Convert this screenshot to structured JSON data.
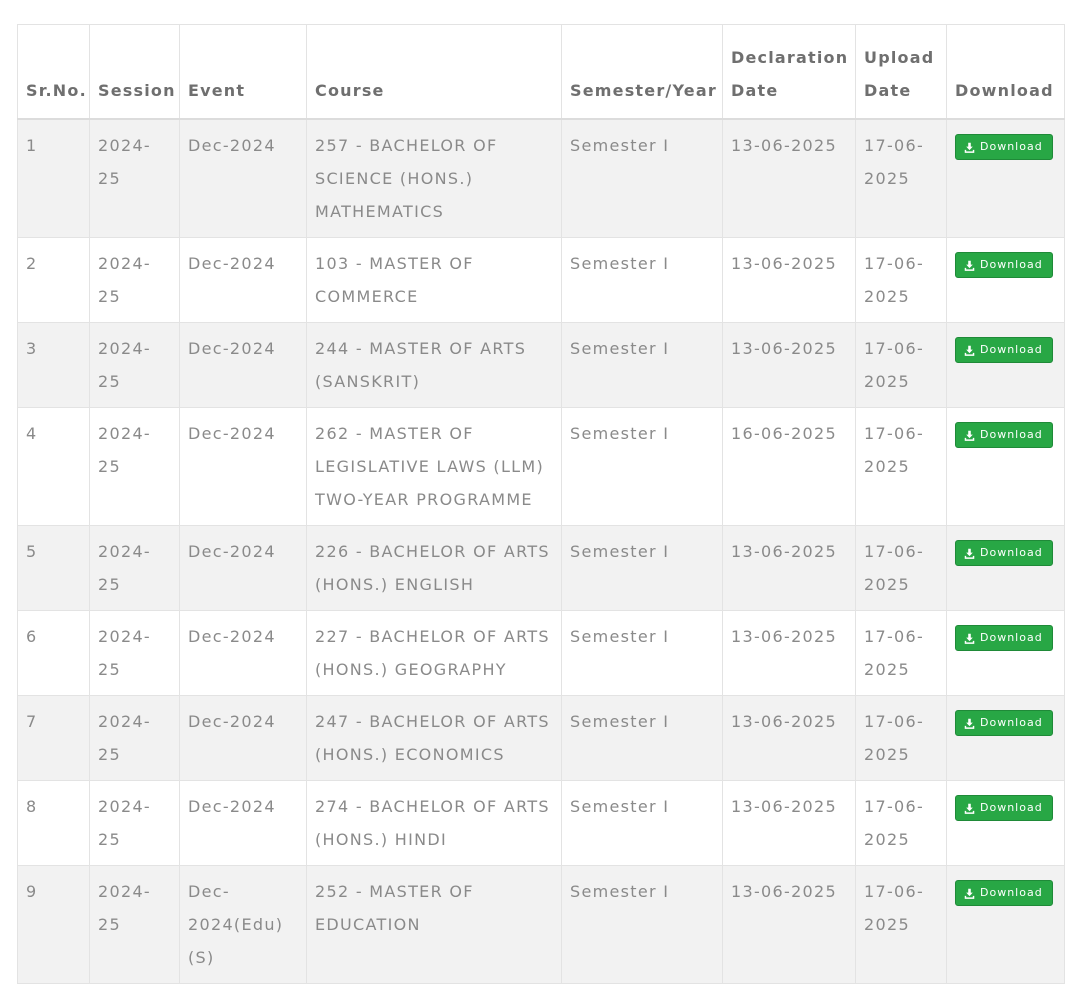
{
  "table": {
    "headers": {
      "sr": "Sr.No.",
      "session": "Session",
      "event": "Event",
      "course": "Course",
      "semester": "Semester/Year",
      "declaration": "Declaration Date",
      "upload": "Upload Date",
      "download": "Download"
    },
    "download_label": "Download",
    "rows": [
      {
        "sr": "1",
        "session": "2024-25",
        "event": "Dec-2024",
        "course": "257 - BACHELOR OF SCIENCE (HONS.) MATHEMATICS",
        "semester": "Semester I",
        "declaration": "13-06-2025",
        "upload": "17-06-2025"
      },
      {
        "sr": "2",
        "session": "2024-25",
        "event": "Dec-2024",
        "course": "103 - MASTER OF COMMERCE",
        "semester": "Semester I",
        "declaration": "13-06-2025",
        "upload": "17-06-2025"
      },
      {
        "sr": "3",
        "session": "2024-25",
        "event": "Dec-2024",
        "course": "244 - MASTER OF ARTS (SANSKRIT)",
        "semester": "Semester I",
        "declaration": "13-06-2025",
        "upload": "17-06-2025"
      },
      {
        "sr": "4",
        "session": "2024-25",
        "event": "Dec-2024",
        "course": "262 - MASTER OF LEGISLATIVE LAWS (LLM) TWO-YEAR PROGRAMME",
        "semester": "Semester I",
        "declaration": "16-06-2025",
        "upload": "17-06-2025"
      },
      {
        "sr": "5",
        "session": "2024-25",
        "event": "Dec-2024",
        "course": "226 - BACHELOR OF ARTS (HONS.) ENGLISH",
        "semester": "Semester I",
        "declaration": "13-06-2025",
        "upload": "17-06-2025"
      },
      {
        "sr": "6",
        "session": "2024-25",
        "event": "Dec-2024",
        "course": "227 - BACHELOR OF ARTS (HONS.) GEOGRAPHY",
        "semester": "Semester I",
        "declaration": "13-06-2025",
        "upload": "17-06-2025"
      },
      {
        "sr": "7",
        "session": "2024-25",
        "event": "Dec-2024",
        "course": "247 - BACHELOR OF ARTS (HONS.) ECONOMICS",
        "semester": "Semester I",
        "declaration": "13-06-2025",
        "upload": "17-06-2025"
      },
      {
        "sr": "8",
        "session": "2024-25",
        "event": "Dec-2024",
        "course": "274 - BACHELOR OF ARTS (HONS.) HINDI",
        "semester": "Semester I",
        "declaration": "13-06-2025",
        "upload": "17-06-2025"
      },
      {
        "sr": "9",
        "session": "2024-25",
        "event": "Dec-2024(Edu)(S)",
        "course": "252 - MASTER OF EDUCATION",
        "semester": "Semester I",
        "declaration": "13-06-2025",
        "upload": "17-06-2025"
      }
    ],
    "colors": {
      "stripe": "#f2f2f2",
      "button": "#28a745",
      "text": "#8a8a8a",
      "header_text": "#6f6f6f"
    }
  }
}
